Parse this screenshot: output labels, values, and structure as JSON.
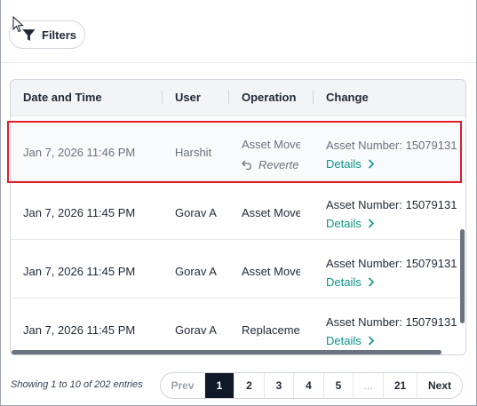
{
  "toolbar": {
    "filters_label": "Filters"
  },
  "table": {
    "headers": [
      "Date and Time",
      "User",
      "Operation",
      "Change"
    ],
    "rows": [
      {
        "date": "Jan 7, 2026 11:46 PM",
        "user": "Harshit",
        "operation": "Asset Move",
        "status": "Reverte",
        "change": "Asset Number: 15079131",
        "details": "Details"
      },
      {
        "date": "Jan 7, 2026 11:45 PM",
        "user": "Gorav A",
        "operation": "Asset Move",
        "change": "Asset Number: 15079131",
        "details": "Details"
      },
      {
        "date": "Jan 7, 2026 11:45 PM",
        "user": "Gorav A",
        "operation": "Asset Move",
        "change": "Asset Number: 15079131",
        "details": "Details"
      },
      {
        "date": "Jan 7, 2026 11:45 PM",
        "user": "Gorav A",
        "operation": "Replaceme",
        "change": "Asset Number: 15079131",
        "details": "Details"
      }
    ]
  },
  "footer": {
    "summary": "Showing 1 to 10 of 202 entries",
    "prev": "Prev",
    "pages": [
      "1",
      "2",
      "3",
      "4",
      "5",
      "...",
      "21"
    ],
    "active_page": "1",
    "next": "Next"
  },
  "colors": {
    "accent_link": "#0d9488",
    "highlight_border": "#e11d2a",
    "active_page_bg": "#111827"
  },
  "icons": {
    "filter": "filter-icon",
    "details": "chevron-right-icon",
    "reverted": "undo-arrow-icon"
  }
}
